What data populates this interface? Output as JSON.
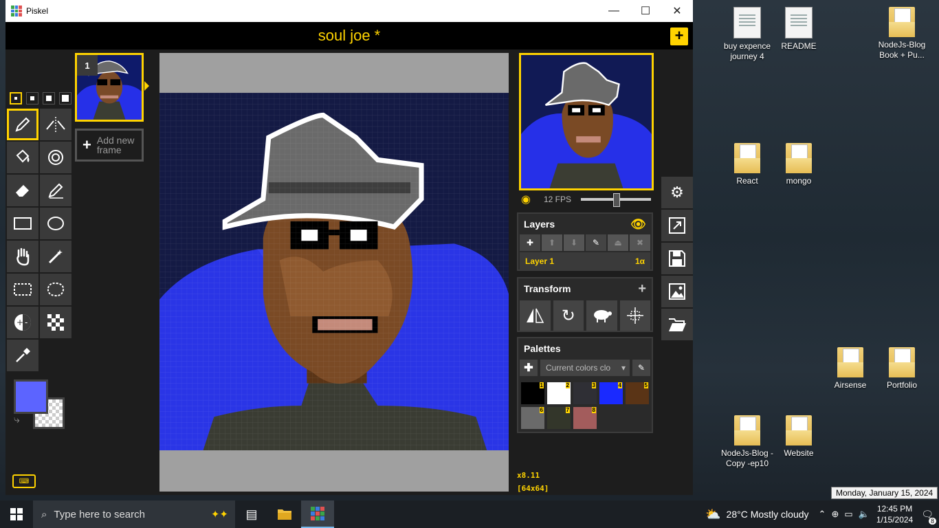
{
  "window": {
    "app_title": "Piskel",
    "minimize": "—",
    "maximize": "☐",
    "close": "✕"
  },
  "header": {
    "doc_title": "soul joe *",
    "add_label": "+"
  },
  "tools": {
    "items": [
      "pen-tool",
      "vertical-mirror-pen",
      "paint-bucket",
      "paint-same-color",
      "eraser",
      "stroke-line",
      "rectangle",
      "circle",
      "move-hand",
      "magic-wand",
      "rectangle-select",
      "lasso-select",
      "lighten",
      "dithering",
      "color-picker"
    ],
    "selected": "pen-tool"
  },
  "colors": {
    "primary": "#5c64ff"
  },
  "frames": {
    "frame_number": "1",
    "add_frame_label": "Add new frame"
  },
  "canvas": {
    "zoom": "x8.11",
    "size": "[64x64]"
  },
  "preview": {
    "fps_label": "12 FPS",
    "fps_value": 12
  },
  "layers": {
    "title": "Layers",
    "items": [
      {
        "name": "Layer 1",
        "opacity": "1α"
      }
    ]
  },
  "transform": {
    "title": "Transform"
  },
  "palettes": {
    "title": "Palettes",
    "selected": "Current colors clo",
    "swatches": [
      {
        "n": "1",
        "color": "#000000"
      },
      {
        "n": "2",
        "color": "#ffffff"
      },
      {
        "n": "3",
        "color": "#2f2f35"
      },
      {
        "n": "4",
        "color": "#1a2aff"
      },
      {
        "n": "5",
        "color": "#5a3416"
      },
      {
        "n": "6",
        "color": "#6a6a6a"
      },
      {
        "n": "7",
        "color": "#33362a"
      },
      {
        "n": "8",
        "color": "#a35c5c"
      }
    ]
  },
  "desktop": {
    "icons": [
      {
        "label": "buy expence journey 4",
        "type": "doc"
      },
      {
        "label": "README",
        "type": "doc"
      },
      {
        "label": "NodeJs-Blog Book + Pu...",
        "type": "folder"
      },
      {
        "label": "React",
        "type": "folder"
      },
      {
        "label": "mongo",
        "type": "folder"
      },
      {
        "label": "Airsense",
        "type": "folder"
      },
      {
        "label": "Portfolio",
        "type": "folder"
      },
      {
        "label": "NodeJs-Blog - Copy -ep10",
        "type": "folder"
      },
      {
        "label": "Website",
        "type": "folder"
      }
    ]
  },
  "taskbar": {
    "search_placeholder": "Type here to search",
    "weather": "28°C  Mostly cloudy",
    "time": "12:45 PM",
    "date": "1/15/2024",
    "notifications": "8",
    "tooltip": "Monday, January 15, 2024"
  }
}
